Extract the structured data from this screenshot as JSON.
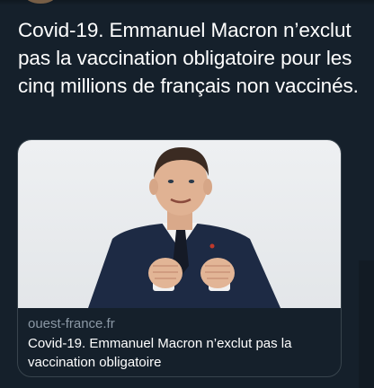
{
  "tweet": {
    "text": "Covid-19. Emmanuel Macron n’exclut pas la vaccination obligatoire pour les cinq millions de français non vaccinés."
  },
  "card": {
    "domain": "ouest-france.fr",
    "title": "Covid-19. Emmanuel Macron n’exclut pas la vaccination obligatoire"
  },
  "colors": {
    "background": "#15202b",
    "card_border": "#38444d",
    "domain_text": "#8b98a5",
    "text": "#ffffff"
  }
}
